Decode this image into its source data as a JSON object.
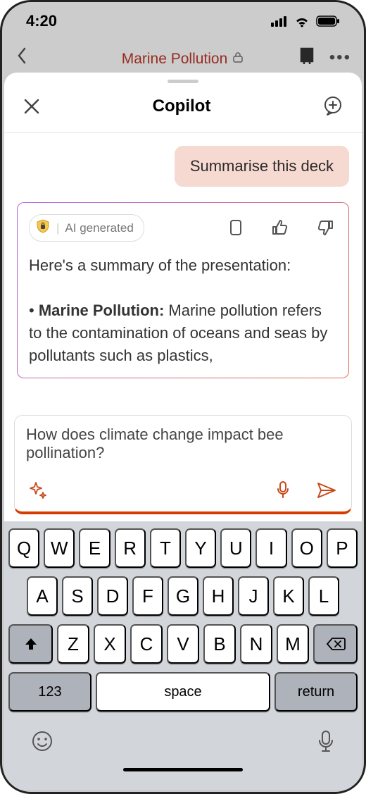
{
  "status": {
    "time": "4:20"
  },
  "background_app": {
    "title": "Marine Pollution"
  },
  "sheet": {
    "title": "Copilot",
    "user_msg": "Summarise this deck",
    "ai_badge_label": "AI generated",
    "ai_summary_intro": "Here's a summary of the presentation:",
    "ai_bullet_title": "Marine Pollution:",
    "ai_bullet_body": " Marine pollution refers to the contamination of oceans and seas by pollutants such as plastics,"
  },
  "input": {
    "text": "How does climate change impact bee pollination?"
  },
  "keyboard": {
    "row1": [
      "Q",
      "W",
      "E",
      "R",
      "T",
      "Y",
      "U",
      "I",
      "O",
      "P"
    ],
    "row2": [
      "A",
      "S",
      "D",
      "F",
      "G",
      "H",
      "J",
      "K",
      "L"
    ],
    "row3": [
      "Z",
      "X",
      "C",
      "V",
      "B",
      "N",
      "M"
    ],
    "numkey": "123",
    "space": "space",
    "return": "return"
  }
}
